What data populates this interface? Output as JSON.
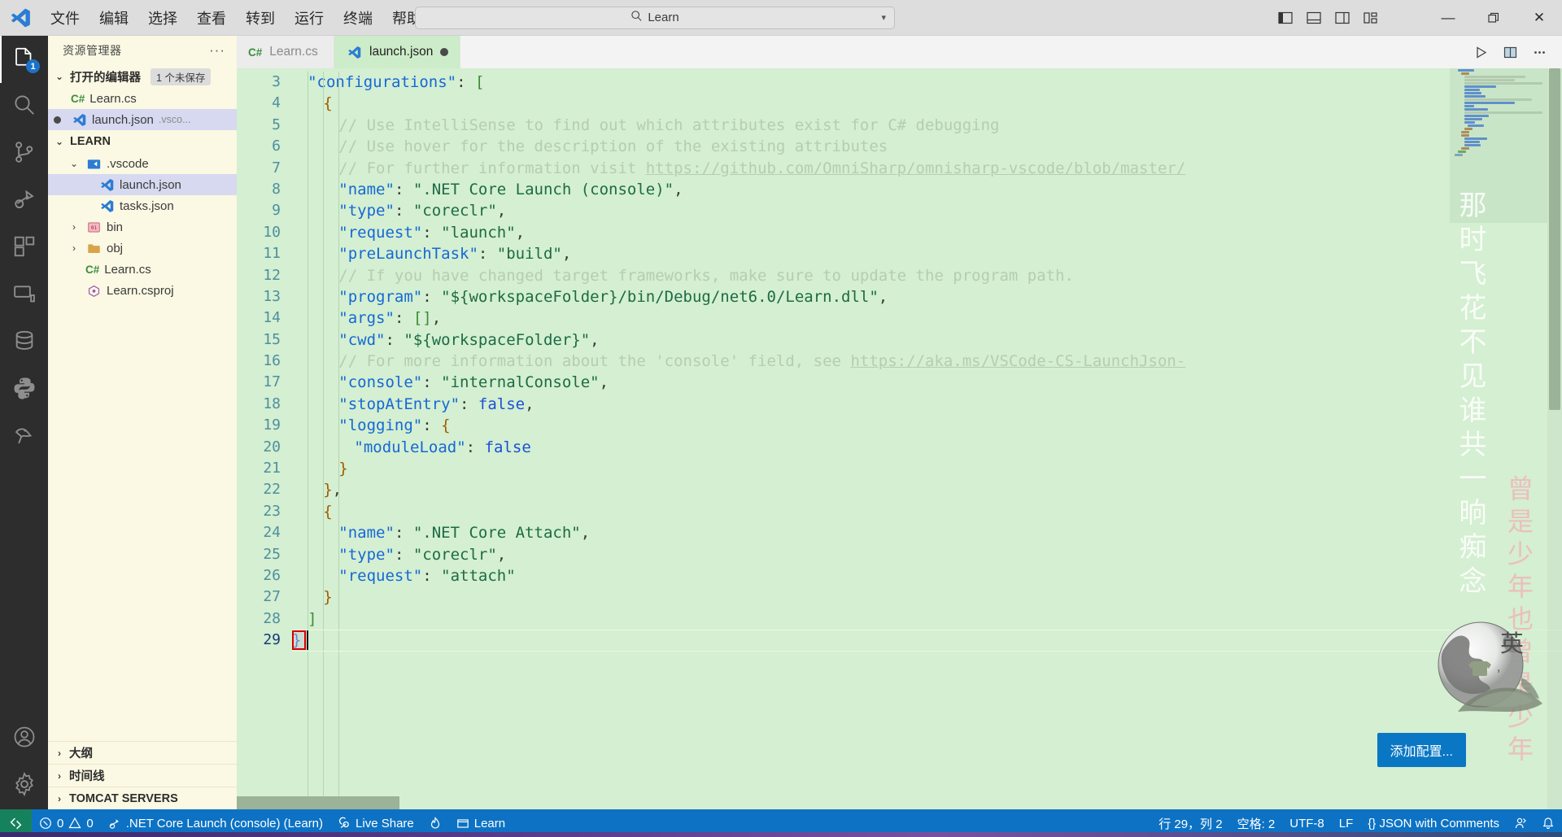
{
  "titlebar": {
    "menus": [
      "文件",
      "编辑",
      "选择",
      "查看",
      "转到",
      "运行",
      "终端",
      "帮助"
    ],
    "back_icon": "arrow-left-icon",
    "forward_icon": "arrow-right-icon",
    "search_value": "Learn",
    "search_icon": "search-icon",
    "layout_icons": [
      "toggle-primary-sidebar-icon",
      "toggle-panel-icon",
      "toggle-secondary-sidebar-icon",
      "customize-layout-icon"
    ],
    "window_controls": {
      "minimize": "minimize-icon",
      "maximize": "restore-icon",
      "close": "close-icon"
    }
  },
  "activitybar": {
    "items": [
      {
        "name": "explorer",
        "icon": "files-icon",
        "badge": "1",
        "active": true
      },
      {
        "name": "search",
        "icon": "search-icon",
        "badge": "",
        "active": false
      },
      {
        "name": "source-control",
        "icon": "source-control-icon",
        "badge": "",
        "active": false
      },
      {
        "name": "run-and-debug",
        "icon": "debug-icon",
        "badge": "",
        "active": false
      },
      {
        "name": "extensions",
        "icon": "extensions-icon",
        "badge": "",
        "active": false
      },
      {
        "name": "remote-explorer",
        "icon": "remote-explorer-icon",
        "badge": "",
        "active": false
      },
      {
        "name": "database",
        "icon": "database-icon",
        "badge": "",
        "active": false
      },
      {
        "name": "python",
        "icon": "python-icon",
        "badge": "",
        "active": false
      },
      {
        "name": "tomcat",
        "icon": "tomcat-icon",
        "badge": "",
        "active": false
      }
    ],
    "bottom": [
      {
        "name": "accounts",
        "icon": "account-icon"
      },
      {
        "name": "manage",
        "icon": "gear-icon"
      }
    ]
  },
  "sidebar": {
    "title": "资源管理器",
    "more_actions": "···",
    "open_editors": {
      "label": "打开的编辑器",
      "badge": "1 个未保存",
      "items": [
        {
          "name": "Learn.cs",
          "icon": "csharp-icon",
          "dirty": false,
          "desc": "",
          "selected": false
        },
        {
          "name": "launch.json",
          "icon": "json-vscode-icon",
          "dirty": true,
          "desc": ".vsco...",
          "selected": true
        }
      ]
    },
    "workspace": {
      "label": "LEARN",
      "items": [
        {
          "name": ".vscode",
          "icon": "vscode-folder-icon",
          "indent": 1,
          "expanded": true,
          "selected": false,
          "chevron": "v"
        },
        {
          "name": "launch.json",
          "icon": "json-vscode-icon",
          "indent": 2,
          "expanded": null,
          "selected": true,
          "chevron": ""
        },
        {
          "name": "tasks.json",
          "icon": "json-vscode-icon",
          "indent": 2,
          "expanded": null,
          "selected": false,
          "chevron": ""
        },
        {
          "name": "bin",
          "icon": "bin-folder-icon",
          "indent": 1,
          "expanded": false,
          "selected": false,
          "chevron": ">"
        },
        {
          "name": "obj",
          "icon": "folder-icon",
          "indent": 1,
          "expanded": false,
          "selected": false,
          "chevron": ">"
        },
        {
          "name": "Learn.cs",
          "icon": "csharp-icon",
          "indent": 1,
          "expanded": null,
          "selected": false,
          "chevron": ""
        },
        {
          "name": "Learn.csproj",
          "icon": "csproj-icon",
          "indent": 1,
          "expanded": null,
          "selected": false,
          "chevron": ""
        }
      ]
    },
    "collapsed_sections": [
      {
        "label": "大纲"
      },
      {
        "label": "时间线"
      },
      {
        "label": "TOMCAT SERVERS"
      }
    ]
  },
  "editor": {
    "tabs": [
      {
        "label": "Learn.cs",
        "icon": "csharp-icon",
        "active": false,
        "dirty": false
      },
      {
        "label": "launch.json",
        "icon": "json-vscode-icon",
        "active": true,
        "dirty": true
      }
    ],
    "actions": [
      {
        "name": "run-icon"
      },
      {
        "name": "split-editor-icon"
      },
      {
        "name": "more-actions-icon"
      }
    ],
    "add_config_button": "添加配置...",
    "first_visible_line": 3,
    "cursor_line": 29,
    "lines": [
      {
        "n": 3,
        "indent": 1,
        "tokens": [
          {
            "t": "\"configurations\"",
            "c": "tok-key"
          },
          {
            "t": ": ",
            "c": "tok-punct"
          },
          {
            "t": "[",
            "c": "tok-brack"
          }
        ]
      },
      {
        "n": 4,
        "indent": 2,
        "tokens": [
          {
            "t": "{",
            "c": "tok-brace"
          }
        ]
      },
      {
        "n": 5,
        "indent": 3,
        "tokens": [
          {
            "t": "// Use IntelliSense to find out which attributes exist for C# debugging",
            "c": "tok-comment"
          }
        ]
      },
      {
        "n": 6,
        "indent": 3,
        "tokens": [
          {
            "t": "// Use hover for the description of the existing attributes",
            "c": "tok-comment"
          }
        ]
      },
      {
        "n": 7,
        "indent": 3,
        "tokens": [
          {
            "t": "// For further information visit ",
            "c": "tok-comment"
          },
          {
            "t": "https://github.com/OmniSharp/omnisharp-vscode/blob/master/",
            "c": "tok-link"
          }
        ]
      },
      {
        "n": 8,
        "indent": 3,
        "tokens": [
          {
            "t": "\"name\"",
            "c": "tok-key"
          },
          {
            "t": ": ",
            "c": "tok-punct"
          },
          {
            "t": "\".NET Core Launch (console)\"",
            "c": "tok-str"
          },
          {
            "t": ",",
            "c": "tok-punct"
          }
        ]
      },
      {
        "n": 9,
        "indent": 3,
        "tokens": [
          {
            "t": "\"type\"",
            "c": "tok-key"
          },
          {
            "t": ": ",
            "c": "tok-punct"
          },
          {
            "t": "\"coreclr\"",
            "c": "tok-str"
          },
          {
            "t": ",",
            "c": "tok-punct"
          }
        ]
      },
      {
        "n": 10,
        "indent": 3,
        "tokens": [
          {
            "t": "\"request\"",
            "c": "tok-key"
          },
          {
            "t": ": ",
            "c": "tok-punct"
          },
          {
            "t": "\"launch\"",
            "c": "tok-str"
          },
          {
            "t": ",",
            "c": "tok-punct"
          }
        ]
      },
      {
        "n": 11,
        "indent": 3,
        "tokens": [
          {
            "t": "\"preLaunchTask\"",
            "c": "tok-key"
          },
          {
            "t": ": ",
            "c": "tok-punct"
          },
          {
            "t": "\"build\"",
            "c": "tok-str"
          },
          {
            "t": ",",
            "c": "tok-punct"
          }
        ]
      },
      {
        "n": 12,
        "indent": 3,
        "tokens": [
          {
            "t": "// If you have changed target frameworks, make sure to update the program path.",
            "c": "tok-comment"
          }
        ]
      },
      {
        "n": 13,
        "indent": 3,
        "tokens": [
          {
            "t": "\"program\"",
            "c": "tok-key"
          },
          {
            "t": ": ",
            "c": "tok-punct"
          },
          {
            "t": "\"${workspaceFolder}/bin/Debug/net6.0/Learn.dll\"",
            "c": "tok-str"
          },
          {
            "t": ",",
            "c": "tok-punct"
          }
        ]
      },
      {
        "n": 14,
        "indent": 3,
        "tokens": [
          {
            "t": "\"args\"",
            "c": "tok-key"
          },
          {
            "t": ": ",
            "c": "tok-punct"
          },
          {
            "t": "[]",
            "c": "tok-brack"
          },
          {
            "t": ",",
            "c": "tok-punct"
          }
        ]
      },
      {
        "n": 15,
        "indent": 3,
        "tokens": [
          {
            "t": "\"cwd\"",
            "c": "tok-key"
          },
          {
            "t": ": ",
            "c": "tok-punct"
          },
          {
            "t": "\"${workspaceFolder}\"",
            "c": "tok-str"
          },
          {
            "t": ",",
            "c": "tok-punct"
          }
        ]
      },
      {
        "n": 16,
        "indent": 3,
        "tokens": [
          {
            "t": "// For more information about the 'console' field, see ",
            "c": "tok-comment"
          },
          {
            "t": "https://aka.ms/VSCode-CS-LaunchJson-",
            "c": "tok-link"
          }
        ]
      },
      {
        "n": 17,
        "indent": 3,
        "tokens": [
          {
            "t": "\"console\"",
            "c": "tok-key"
          },
          {
            "t": ": ",
            "c": "tok-punct"
          },
          {
            "t": "\"internalConsole\"",
            "c": "tok-str"
          },
          {
            "t": ",",
            "c": "tok-punct"
          }
        ]
      },
      {
        "n": 18,
        "indent": 3,
        "tokens": [
          {
            "t": "\"stopAtEntry\"",
            "c": "tok-key"
          },
          {
            "t": ": ",
            "c": "tok-punct"
          },
          {
            "t": "false",
            "c": "tok-bool"
          },
          {
            "t": ",",
            "c": "tok-punct"
          }
        ]
      },
      {
        "n": 19,
        "indent": 3,
        "tokens": [
          {
            "t": "\"logging\"",
            "c": "tok-key"
          },
          {
            "t": ": ",
            "c": "tok-punct"
          },
          {
            "t": "{",
            "c": "tok-brace"
          }
        ]
      },
      {
        "n": 20,
        "indent": 4,
        "tokens": [
          {
            "t": "\"moduleLoad\"",
            "c": "tok-key"
          },
          {
            "t": ": ",
            "c": "tok-punct"
          },
          {
            "t": "false",
            "c": "tok-bool"
          }
        ]
      },
      {
        "n": 21,
        "indent": 3,
        "tokens": [
          {
            "t": "}",
            "c": "tok-brace"
          }
        ]
      },
      {
        "n": 22,
        "indent": 2,
        "tokens": [
          {
            "t": "}",
            "c": "tok-brace"
          },
          {
            "t": ",",
            "c": "tok-punct"
          }
        ]
      },
      {
        "n": 23,
        "indent": 2,
        "tokens": [
          {
            "t": "{",
            "c": "tok-brace"
          }
        ]
      },
      {
        "n": 24,
        "indent": 3,
        "tokens": [
          {
            "t": "\"name\"",
            "c": "tok-key"
          },
          {
            "t": ": ",
            "c": "tok-punct"
          },
          {
            "t": "\".NET Core Attach\"",
            "c": "tok-str"
          },
          {
            "t": ",",
            "c": "tok-punct"
          }
        ]
      },
      {
        "n": 25,
        "indent": 3,
        "tokens": [
          {
            "t": "\"type\"",
            "c": "tok-key"
          },
          {
            "t": ": ",
            "c": "tok-punct"
          },
          {
            "t": "\"coreclr\"",
            "c": "tok-str"
          },
          {
            "t": ",",
            "c": "tok-punct"
          }
        ]
      },
      {
        "n": 26,
        "indent": 3,
        "tokens": [
          {
            "t": "\"request\"",
            "c": "tok-key"
          },
          {
            "t": ": ",
            "c": "tok-punct"
          },
          {
            "t": "\"attach\"",
            "c": "tok-str"
          }
        ]
      },
      {
        "n": 27,
        "indent": 2,
        "tokens": [
          {
            "t": "}",
            "c": "tok-brace"
          }
        ]
      },
      {
        "n": 28,
        "indent": 1,
        "tokens": [
          {
            "t": "]",
            "c": "tok-brack"
          }
        ]
      },
      {
        "n": 29,
        "indent": 0,
        "tokens": [
          {
            "t": "}",
            "c": "tok-bool"
          }
        ]
      }
    ]
  },
  "watermarks": {
    "white_vertical": "那时飞花不见谁共一晌痴念",
    "pink_vertical": "曾是少年也曾是少年",
    "globe_char": "英"
  },
  "statusbar": {
    "remote_icon": "remote-window-icon",
    "left": [
      {
        "name": "problems",
        "icon": "error-warning-icon",
        "label": "0 ⚠ 0",
        "errors": "0",
        "warnings": "0"
      },
      {
        "name": "launch-config",
        "icon": "debug-small-icon",
        "label": ".NET Core Launch (console) (Learn)"
      },
      {
        "name": "live-share",
        "icon": "live-share-icon",
        "label": "Live Share"
      },
      {
        "name": "flame",
        "icon": "flame-icon",
        "label": ""
      },
      {
        "name": "folder",
        "icon": "folder-small-icon",
        "label": "Learn"
      }
    ],
    "right": [
      {
        "name": "cursor-position",
        "label": "行 29，列 2"
      },
      {
        "name": "indentation",
        "label": "空格: 2"
      },
      {
        "name": "encoding",
        "label": "UTF-8"
      },
      {
        "name": "eol",
        "label": "LF"
      },
      {
        "name": "language-mode",
        "label": "{} JSON with Comments"
      },
      {
        "name": "feedback",
        "icon": "feedback-icon",
        "label": ""
      },
      {
        "name": "notifications",
        "icon": "bell-icon",
        "label": ""
      }
    ]
  },
  "colors": {
    "accent": "#0d72c4",
    "remote_green": "#16825d",
    "editor_bg": "#d4efd1",
    "sidebar_bg": "#fbf8e3",
    "activitybar_bg": "#2d2d2d",
    "titlebar_bg": "#dddddd"
  }
}
